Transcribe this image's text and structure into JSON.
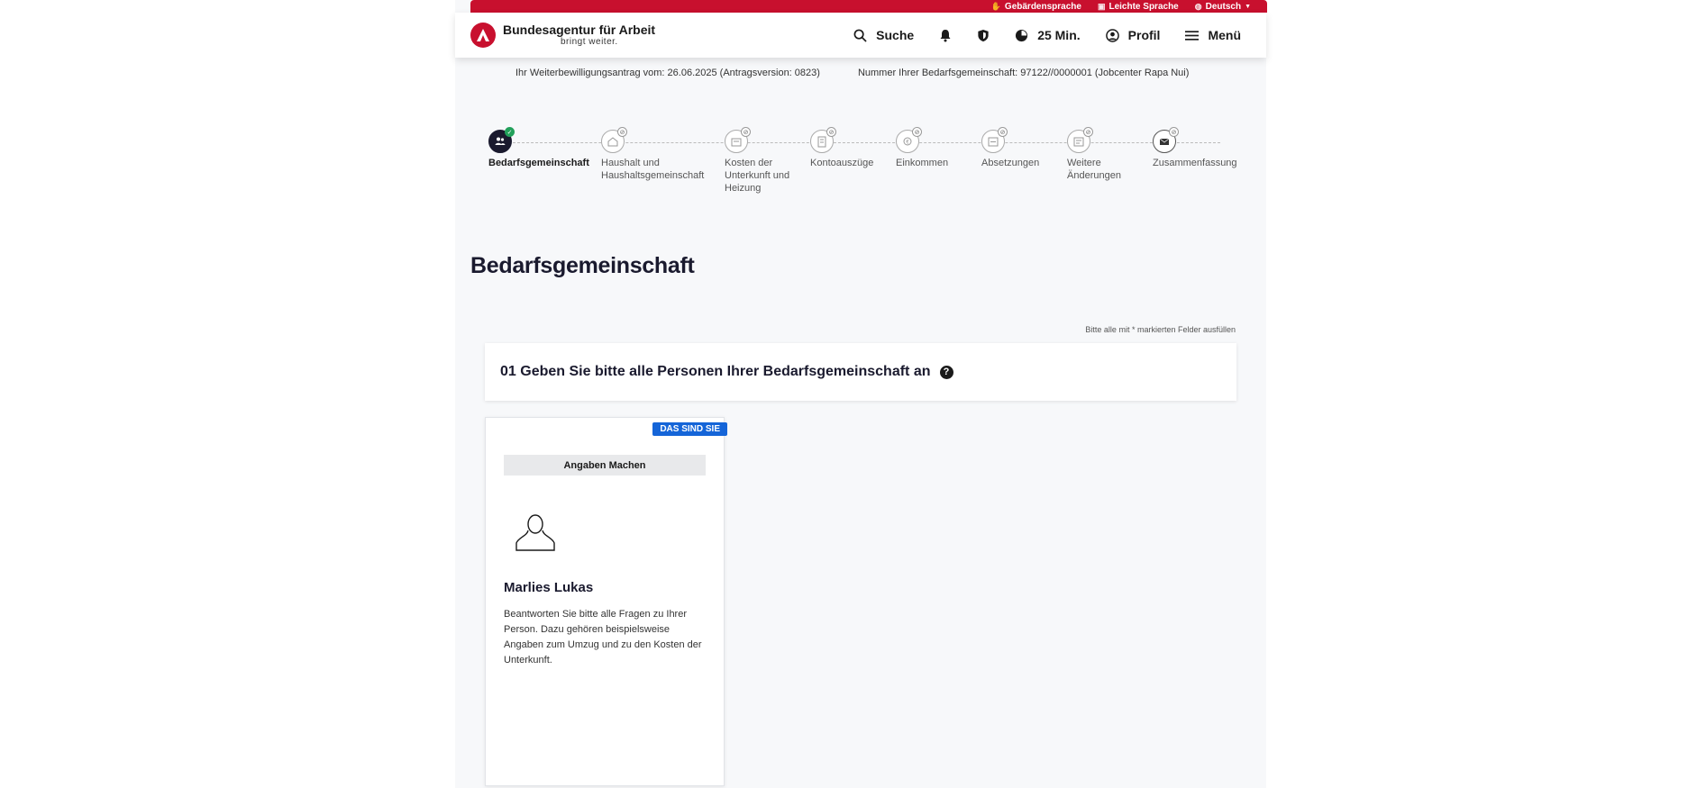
{
  "topbar": {
    "items": [
      {
        "label": "Gebärdensprache",
        "icon": "hand-icon"
      },
      {
        "label": "Leichte Sprache",
        "icon": "book-icon"
      },
      {
        "label": "Deutsch",
        "icon": "globe-icon"
      }
    ]
  },
  "header": {
    "logo_title": "Bundesagentur für Arbeit",
    "logo_sub": "bringt weiter.",
    "nav": {
      "search": "Suche",
      "timer": "25 Min.",
      "profile": "Profil",
      "menu": "Menü"
    }
  },
  "info": {
    "application": "Ihr Weiterbewilligungsantrag vom: 26.06.2025 (Antragsversion: 0823)",
    "community_number": "Nummer Ihrer Bedarfsgemeinschaft: 97122//0000001 (Jobcenter Rapa Nui)"
  },
  "steps": [
    {
      "label": "Bedarfsgemeinschaft",
      "active": true
    },
    {
      "label": "Haushalt und Haushaltsgemeinschaft"
    },
    {
      "label": "Kosten der Unterkunft und Heizung"
    },
    {
      "label": "Kontoauszüge"
    },
    {
      "label": "Einkommen"
    },
    {
      "label": "Absetzungen"
    },
    {
      "label": "Weitere Änderungen"
    },
    {
      "label": "Zusammenfassung"
    }
  ],
  "main": {
    "title": "Bedarfsgemeinschaft",
    "required_note": "Bitte alle mit * markierten Felder ausfüllen",
    "section_title": "01 Geben Sie bitte alle Personen Ihrer Bedarfsgemeinschaft an",
    "help": "?"
  },
  "card": {
    "badge": "DAS SIND SIE",
    "button": "Angaben Machen",
    "name": "Marlies Lukas",
    "description": "Beantworten Sie bitte alle Fragen zu Ihrer Person. Dazu gehören beispielsweise Angaben zum Umzug und zu den Kosten der Unterkunft."
  },
  "colors": {
    "brand_red": "#c8102e",
    "badge_blue": "#1565d8",
    "success_green": "#22a05a"
  }
}
